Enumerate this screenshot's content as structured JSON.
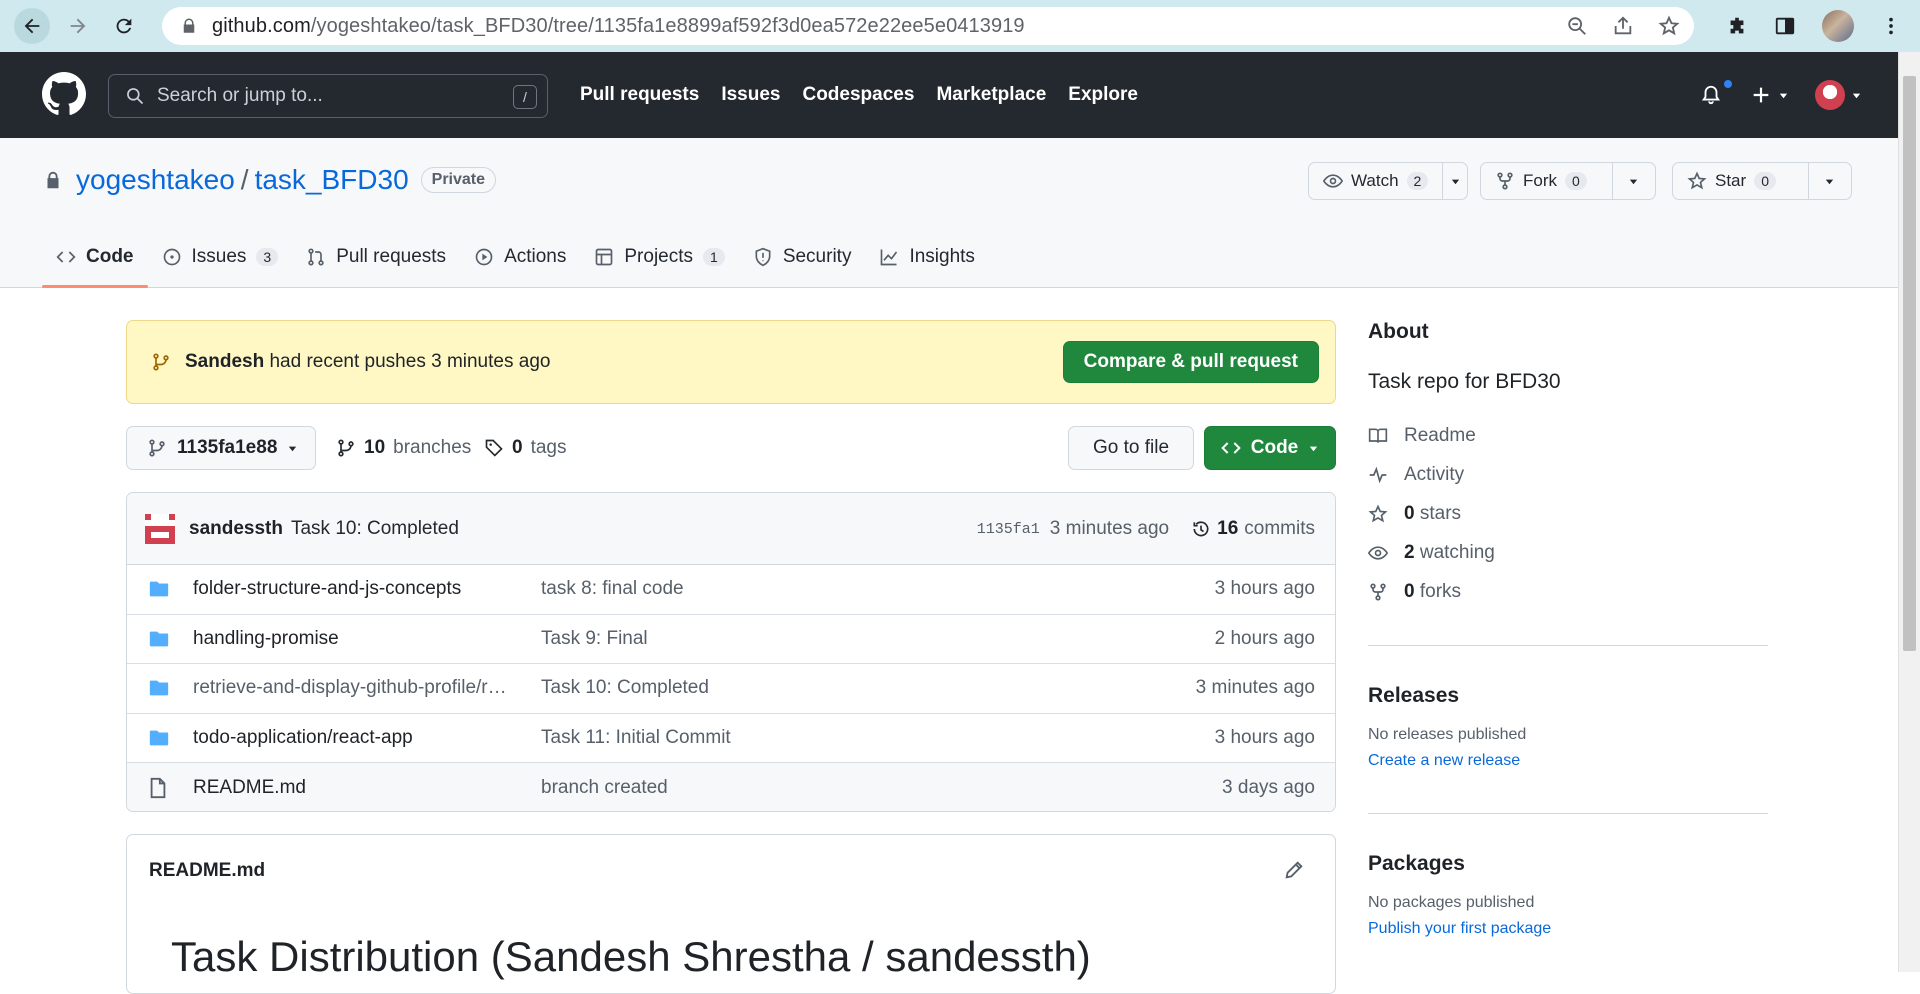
{
  "browser": {
    "url_domain": "github.com",
    "url_path": "/yogeshtakeo/task_BFD30/tree/1135fa1e8899af592f3d0ea572e22ee5e0413919"
  },
  "gh": {
    "search_placeholder": "Search or jump to...",
    "slash_hint": "/",
    "nav": [
      "Pull requests",
      "Issues",
      "Codespaces",
      "Marketplace",
      "Explore"
    ]
  },
  "repo": {
    "owner": "yogeshtakeo",
    "sep": "/",
    "name": "task_BFD30",
    "visibility": "Private",
    "watch_label": "Watch",
    "watch_count": "2",
    "fork_label": "Fork",
    "fork_count": "0",
    "star_label": "Star",
    "star_count": "0"
  },
  "tabs": [
    {
      "label": "Code",
      "count": ""
    },
    {
      "label": "Issues",
      "count": "3"
    },
    {
      "label": "Pull requests",
      "count": ""
    },
    {
      "label": "Actions",
      "count": ""
    },
    {
      "label": "Projects",
      "count": "1"
    },
    {
      "label": "Security",
      "count": ""
    },
    {
      "label": "Insights",
      "count": ""
    }
  ],
  "banner": {
    "user": "Sandesh",
    "text": "had recent pushes 3 minutes ago",
    "button": "Compare & pull request"
  },
  "toolbar": {
    "branch": "1135fa1e88",
    "branches_count": "10",
    "branches_label": "branches",
    "tags_count": "0",
    "tags_label": "tags",
    "go_to_file": "Go to file",
    "code": "Code"
  },
  "latest_commit": {
    "author": "sandessth",
    "message": "Task 10: Completed",
    "sha": "1135fa1",
    "time": "3 minutes ago",
    "commits_count": "16",
    "commits_label": "commits"
  },
  "files": [
    {
      "name": "folder-structure-and-js-concepts",
      "type": "dir",
      "message": "task 8: final code",
      "age": "3 hours ago"
    },
    {
      "name": "handling-promise",
      "type": "dir",
      "message": "Task 9: Final",
      "age": "2 hours ago"
    },
    {
      "name": "retrieve-and-display-github-profile/r…",
      "type": "dir",
      "message": "Task 10: Completed",
      "age": "3 minutes ago"
    },
    {
      "name": "todo-application/react-app",
      "type": "dir",
      "message": "Task 11: Initial Commit",
      "age": "3 hours ago"
    },
    {
      "name": "README.md",
      "type": "file",
      "message": "branch created",
      "age": "3 days ago"
    }
  ],
  "readme": {
    "filename": "README.md",
    "heading": "Task Distribution (Sandesh Shrestha / sandessth)"
  },
  "about": {
    "title": "About",
    "description": "Task repo for BFD30",
    "readme": "Readme",
    "activity": "Activity",
    "stars_count": "0",
    "stars_label": "stars",
    "watching_count": "2",
    "watching_label": "watching",
    "forks_count": "0",
    "forks_label": "forks"
  },
  "releases": {
    "title": "Releases",
    "none": "No releases published",
    "link": "Create a new release"
  },
  "packages": {
    "title": "Packages",
    "none": "No packages published",
    "link": "Publish your first package"
  },
  "colors": {
    "accent_green": "#1f883d",
    "link_blue": "#0969da",
    "header_dark": "#24292f",
    "banner_yellow": "#fff8c5",
    "folder_blue": "#54aeff",
    "active_tab_underline": "#fd8c73"
  }
}
